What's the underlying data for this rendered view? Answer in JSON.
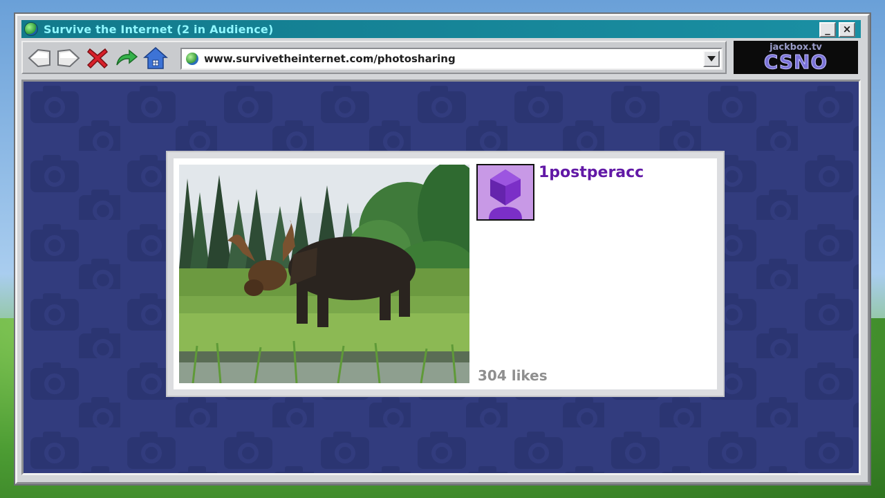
{
  "window": {
    "title": "Survive the Internet  (2 in Audience)",
    "minimize_label": "_",
    "close_label": "×"
  },
  "toolbar": {
    "buttons": [
      {
        "icon": "back-arrow-icon"
      },
      {
        "icon": "forward-arrow-icon"
      },
      {
        "icon": "stop-x-icon"
      },
      {
        "icon": "refresh-arrow-icon"
      },
      {
        "icon": "home-icon"
      }
    ]
  },
  "address_bar": {
    "url": "www.survivetheinternet.com/photosharing",
    "icon": "globe-icon"
  },
  "brand": {
    "subtitle": "jackbox.tv",
    "code": "CSNO"
  },
  "post": {
    "username": "1postperacc",
    "likes": "304 likes",
    "photo_subject": "moose in grassy marsh",
    "avatar_icon": "purple-gem-avatar-icon"
  },
  "colors": {
    "title_bar": "#127a8c",
    "title_text": "#8ff7ff",
    "content_background": "#323c7e",
    "username": "#6219a6",
    "likes": "#8f8f8f",
    "brand_text": "#7a72d6"
  }
}
